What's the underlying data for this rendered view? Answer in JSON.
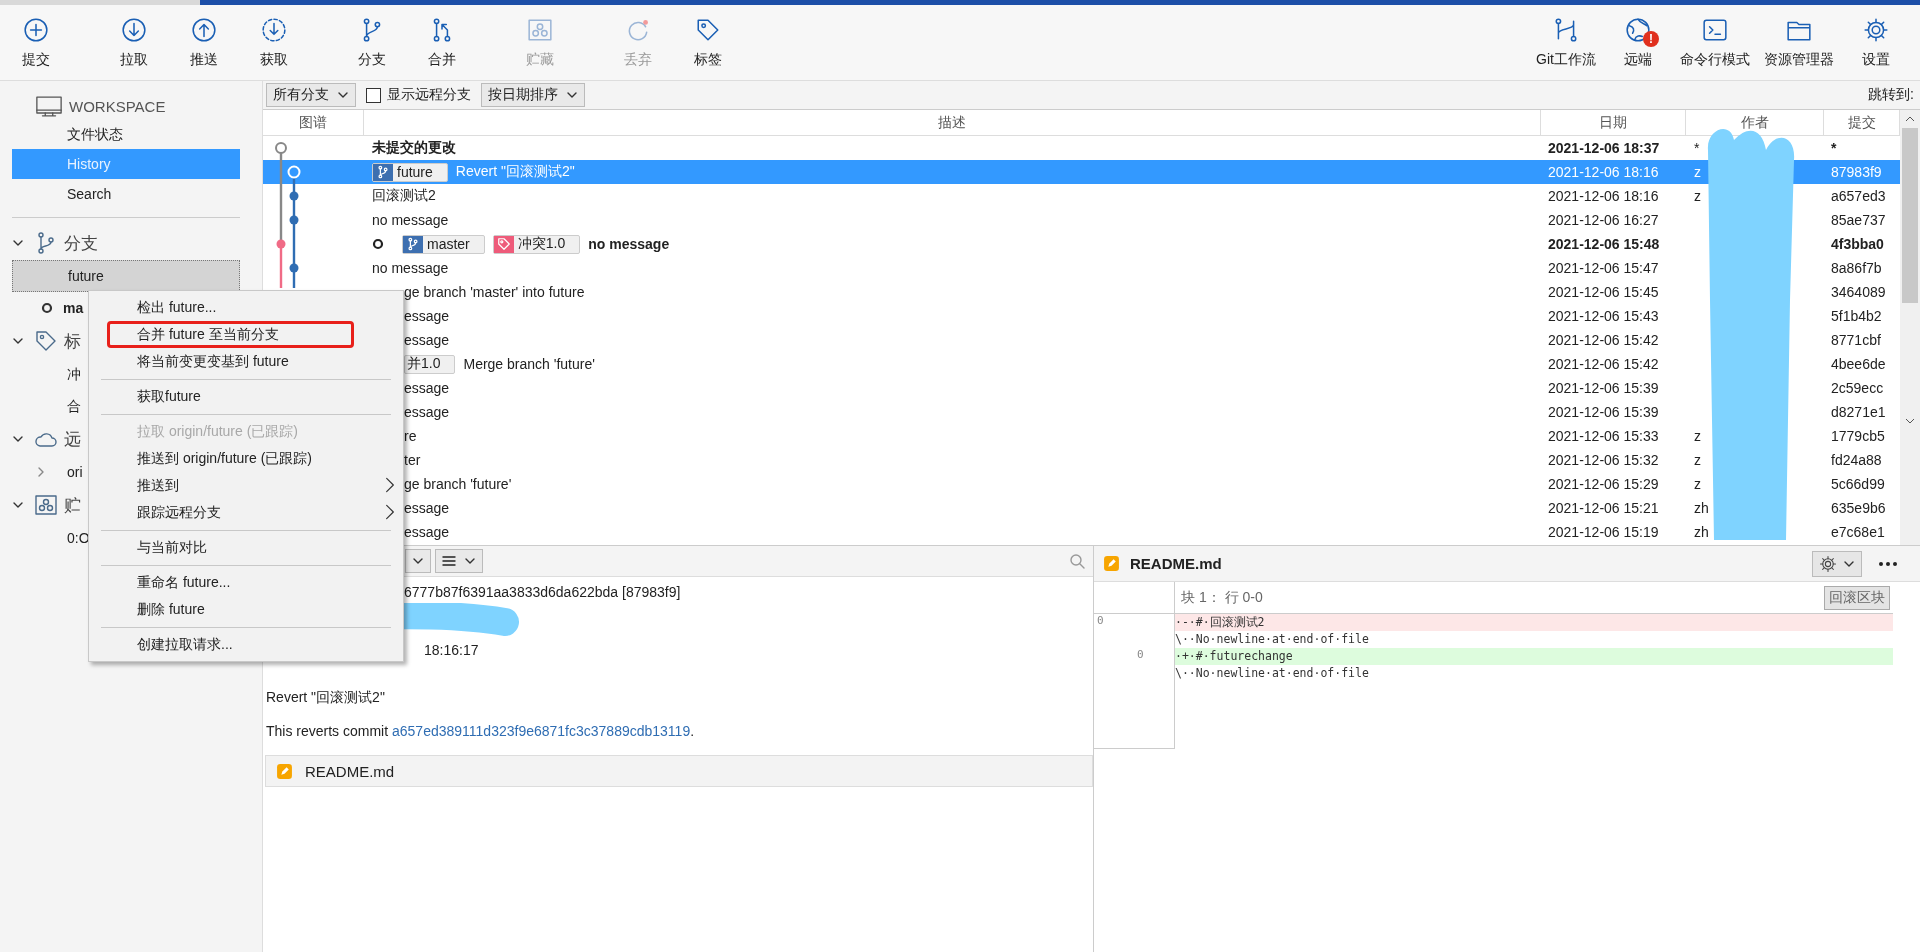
{
  "toolbar": {
    "left": [
      {
        "kind": "commit",
        "label": "提交",
        "disabled": false
      },
      {
        "kind": "pull",
        "label": "拉取",
        "disabled": false
      },
      {
        "kind": "push",
        "label": "推送",
        "disabled": false
      },
      {
        "kind": "fetch",
        "label": "获取",
        "disabled": false
      },
      {
        "kind": "branch",
        "label": "分支",
        "disabled": false
      },
      {
        "kind": "merge",
        "label": "合并",
        "disabled": false
      },
      {
        "kind": "stash",
        "label": "贮藏",
        "disabled": true
      },
      {
        "kind": "discard",
        "label": "丢弃",
        "disabled": true
      },
      {
        "kind": "tag",
        "label": "标签",
        "disabled": false
      }
    ],
    "right": [
      {
        "kind": "gitflow",
        "label": "Git工作流",
        "disabled": false
      },
      {
        "kind": "remote",
        "label": "远端",
        "disabled": false,
        "alert": "!"
      },
      {
        "kind": "terminal",
        "label": "命令行模式",
        "disabled": false
      },
      {
        "kind": "explorer",
        "label": "资源管理器",
        "disabled": false
      },
      {
        "kind": "settings",
        "label": "设置",
        "disabled": false
      }
    ]
  },
  "sidebar": {
    "workspace": {
      "title": "WORKSPACE",
      "items": [
        {
          "label": "文件状态",
          "selected": false
        },
        {
          "label": "History",
          "selected": true
        },
        {
          "label": "Search",
          "selected": false
        }
      ]
    },
    "sections": [
      {
        "kind": "branches",
        "title": "分支",
        "expanded": true,
        "items": [
          {
            "label": "future",
            "selected": true,
            "current": false
          },
          {
            "label": "ma",
            "selected": false,
            "current": true
          }
        ]
      },
      {
        "kind": "tags",
        "title": "标",
        "expanded": true,
        "items": [
          {
            "label": "冲",
            "selected": false
          },
          {
            "label": "合",
            "selected": false
          }
        ]
      },
      {
        "kind": "remotes",
        "title": "远",
        "expanded": true,
        "items": [
          {
            "label": "ori",
            "selected": false,
            "expandable": true
          }
        ]
      },
      {
        "kind": "stashes",
        "title": "贮",
        "expanded": true,
        "items": [
          {
            "label": "0:O",
            "selected": false
          }
        ]
      }
    ]
  },
  "filter_bar": {
    "branch_filter": "所有分支",
    "show_remote": {
      "label": "显示远程分支",
      "checked": false
    },
    "sort": "按日期排序",
    "jump_label": "跳转到:"
  },
  "table": {
    "columns": [
      "图谱",
      "描述",
      "日期",
      "作者",
      "提交"
    ],
    "rows": [
      {
        "description": "未提交的更改",
        "bold": true,
        "date": "2021-12-06 18:37",
        "author": "*",
        "commit": "*",
        "selected": false
      },
      {
        "refs": [
          {
            "kind": "branch",
            "label": "future"
          }
        ],
        "description": "Revert \"回滚测试2\"",
        "bold": false,
        "date": "2021-12-06 18:16",
        "author": "z",
        "commit": "87983f9",
        "selected": true
      },
      {
        "description": "回滚测试2",
        "bold": false,
        "date": "2021-12-06 18:16",
        "author": "z",
        "commit": "a657ed3",
        "selected": false
      },
      {
        "description": "no message",
        "bold": false,
        "date": "2021-12-06 16:27",
        "commit": "85ae737",
        "selected": false
      },
      {
        "head": true,
        "refs": [
          {
            "kind": "branch",
            "label": "master"
          },
          {
            "kind": "tag",
            "label": "冲突1.0"
          }
        ],
        "description": "no message",
        "bold": true,
        "date": "2021-12-06 15:48",
        "commit": "4f3bba0",
        "selected": false
      },
      {
        "description": "no message",
        "bold": false,
        "date": "2021-12-06 15:47",
        "commit": "8a86f7b",
        "selected": false
      },
      {
        "covered": true,
        "description": "ge branch 'master' into future",
        "bold": false,
        "date": "2021-12-06 15:45",
        "commit": "3464089",
        "selected": false
      },
      {
        "covered": true,
        "description": "essage",
        "bold": false,
        "date": "2021-12-06 15:43",
        "commit": "5f1b4b2",
        "selected": false
      },
      {
        "covered": true,
        "description": "essage",
        "bold": false,
        "date": "2021-12-06 15:42",
        "commit": "8771cbf",
        "selected": false
      },
      {
        "covered": true,
        "refs": [
          {
            "kind": "tag",
            "label": "并1.0"
          }
        ],
        "description": "Merge branch 'future'",
        "bold": false,
        "date": "2021-12-06 15:42",
        "commit": "4bee6de",
        "selected": false
      },
      {
        "covered": true,
        "description": "essage",
        "bold": false,
        "date": "2021-12-06 15:39",
        "commit": "2c59ecc",
        "selected": false
      },
      {
        "covered": true,
        "description": "essage",
        "bold": false,
        "date": "2021-12-06 15:39",
        "commit": "d8271e1",
        "selected": false
      },
      {
        "covered": true,
        "description": "re",
        "bold": false,
        "date": "2021-12-06 15:33",
        "author": "z",
        "commit": "1779cb5",
        "selected": false
      },
      {
        "covered": true,
        "description": "ter",
        "bold": false,
        "date": "2021-12-06 15:32",
        "author": "z",
        "commit": "fd24a88",
        "selected": false
      },
      {
        "covered": true,
        "description": "ge branch 'future'",
        "bold": false,
        "date": "2021-12-06 15:29",
        "author": "z",
        "commit": "5c66d99",
        "selected": false
      },
      {
        "covered": true,
        "description": "essage",
        "bold": false,
        "date": "2021-12-06 15:21",
        "author": "zh",
        "commit": "635e9b6",
        "selected": false
      },
      {
        "covered": true,
        "description": "essage",
        "bold": false,
        "date": "2021-12-06 15:19",
        "author": "zh",
        "commit": "e7c68e1",
        "selected": false
      }
    ]
  },
  "details": {
    "commit_line": "6777b87f6391aa3833d6da622bda [87983f9]",
    "date_line": "18:16:17",
    "message": "Revert \"回滚测试2\"",
    "body": "This reverts commit ",
    "link": "a657ed389111d323f9e6871fc3c37889cdb13119",
    "body_end": ".",
    "files": [
      {
        "name": "README.md"
      }
    ]
  },
  "diff": {
    "file": "README.md",
    "hunk": {
      "title": "块 1： 行 0-0",
      "button": "回滚区块"
    },
    "lines": [
      {
        "kind": "removed",
        "old": "0",
        "text": "·-·#·回滚测试2"
      },
      {
        "kind": "context",
        "text": "\\··No·newline·at·end·of·file"
      },
      {
        "kind": "added",
        "new": "0",
        "text": "·+·#·futurechange"
      },
      {
        "kind": "context",
        "text": "\\··No·newline·at·end·of·file"
      }
    ]
  },
  "context_menu": {
    "items": [
      {
        "kind": "item",
        "label": "检出 future...",
        "disabled": false,
        "highlighted": false,
        "submenu": false
      },
      {
        "kind": "item",
        "label": "合并 future 至当前分支",
        "disabled": false,
        "highlighted": true,
        "submenu": false
      },
      {
        "kind": "item",
        "label": "将当前变更变基到 future",
        "disabled": false,
        "highlighted": false,
        "submenu": false
      },
      {
        "kind": "separator"
      },
      {
        "kind": "item",
        "label": "获取future",
        "disabled": false,
        "highlighted": false,
        "submenu": false
      },
      {
        "kind": "separator"
      },
      {
        "kind": "item",
        "label": "拉取 origin/future (已跟踪)",
        "disabled": true,
        "highlighted": false,
        "submenu": false
      },
      {
        "kind": "item",
        "label": "推送到 origin/future (已跟踪)",
        "disabled": false,
        "highlighted": false,
        "submenu": false
      },
      {
        "kind": "item",
        "label": "推送到",
        "disabled": false,
        "highlighted": false,
        "submenu": true
      },
      {
        "kind": "item",
        "label": "跟踪远程分支",
        "disabled": false,
        "highlighted": false,
        "submenu": true
      },
      {
        "kind": "separator"
      },
      {
        "kind": "item",
        "label": "与当前对比",
        "disabled": false,
        "highlighted": false,
        "submenu": false
      },
      {
        "kind": "separator"
      },
      {
        "kind": "item",
        "label": "重命名 future...",
        "disabled": false,
        "highlighted": false,
        "submenu": false
      },
      {
        "kind": "item",
        "label": "删除 future",
        "disabled": false,
        "highlighted": false,
        "submenu": false
      },
      {
        "kind": "separator"
      },
      {
        "kind": "item",
        "label": "创建拉取请求...",
        "disabled": false,
        "highlighted": false,
        "submenu": false
      }
    ]
  }
}
